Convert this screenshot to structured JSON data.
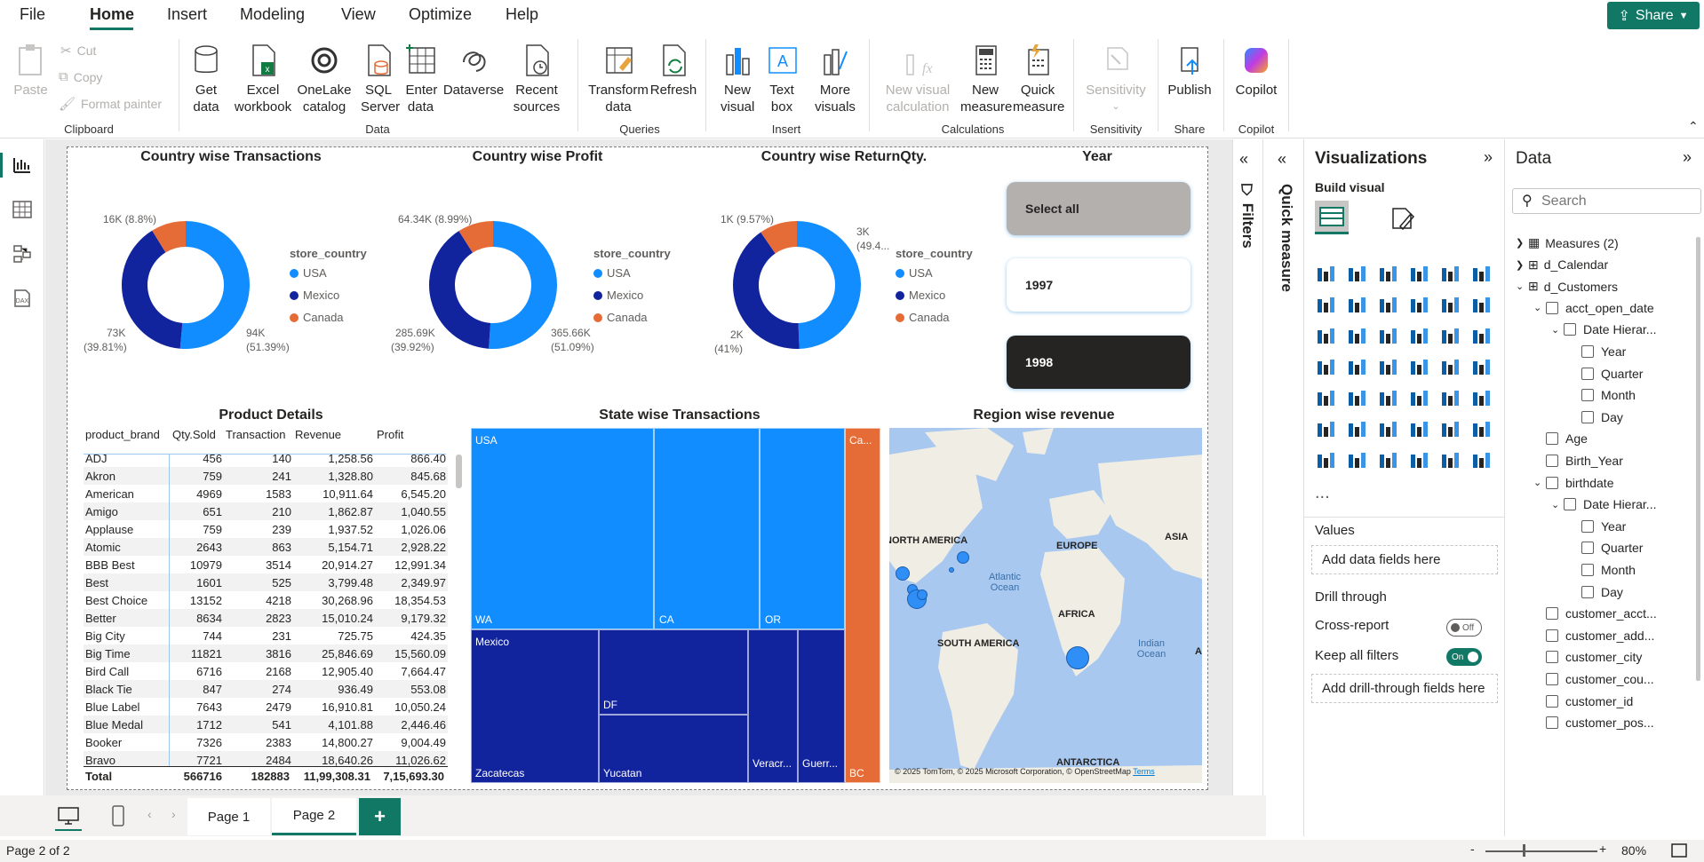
{
  "menu": {
    "file": "File",
    "home": "Home",
    "insert": "Insert",
    "modeling": "Modeling",
    "view": "View",
    "optimize": "Optimize",
    "help": "Help",
    "share": "Share"
  },
  "ribbon": {
    "clipboard": {
      "paste": "Paste",
      "cut": "Cut",
      "copy": "Copy",
      "format_painter": "Format painter",
      "label": "Clipboard"
    },
    "data": {
      "get_data": "Get data",
      "excel": "Excel workbook",
      "onelake": "OneLake catalog",
      "sql": "SQL Server",
      "enter": "Enter data",
      "dataverse": "Dataverse",
      "recent": "Recent sources",
      "label": "Data"
    },
    "queries": {
      "transform": "Transform data",
      "refresh": "Refresh",
      "label": "Queries"
    },
    "insert": {
      "new_visual": "New visual",
      "text_box": "Text box",
      "more_visuals": "More visuals",
      "label": "Insert"
    },
    "calculations": {
      "new_visual_calc": "New visual calculation",
      "new_measure": "New measure",
      "quick_measure": "Quick measure",
      "label": "Calculations"
    },
    "sensitivity": {
      "btn": "Sensitivity",
      "label": "Sensitivity"
    },
    "share": {
      "publish": "Publish",
      "label": "Share"
    },
    "copilot": {
      "btn": "Copilot",
      "label": "Copilot"
    }
  },
  "donuts": [
    {
      "title": "Country wise Transactions",
      "legend_title": "store_country",
      "legend": [
        "USA",
        "Mexico",
        "Canada"
      ],
      "values": [
        51.39,
        39.81,
        8.8
      ],
      "labels": {
        "canada": "16K (8.8%)",
        "mexico_a": "73K",
        "mexico_b": "(39.81%)",
        "usa_a": "94K",
        "usa_b": "(51.39%)"
      }
    },
    {
      "title": "Country wise Profit",
      "legend_title": "store_country",
      "legend": [
        "USA",
        "Mexico",
        "Canada"
      ],
      "values": [
        51.09,
        39.92,
        8.99
      ],
      "labels": {
        "canada": "64.34K (8.99%)",
        "mexico_a": "285.69K",
        "mexico_b": "(39.92%)",
        "usa_a": "365.66K",
        "usa_b": "(51.09%)"
      }
    },
    {
      "title": "Country wise ReturnQty.",
      "legend_title": "store_country",
      "legend": [
        "USA",
        "Mexico",
        "Canada"
      ],
      "values": [
        49.4,
        41,
        9.57
      ],
      "labels": {
        "canada": "1K (9.57%)",
        "mexico_a": "2K",
        "mexico_b": "(41%)",
        "usa_a": "3K",
        "usa_b": "(49.4..."
      }
    }
  ],
  "colors": {
    "usa": "#118dff",
    "mexico": "#12239e",
    "canada": "#e66c37",
    "accent": "#117865"
  },
  "year_slicer": {
    "title": "Year",
    "options": [
      "Select all",
      "1997",
      "1998"
    ]
  },
  "product_table": {
    "title": "Product Details",
    "columns": [
      "product_brand",
      "Qty.Sold",
      "Transaction",
      "Revenue",
      "Profit"
    ],
    "rows": [
      [
        "ADJ",
        "456",
        "140",
        "1,258.56",
        "866.40"
      ],
      [
        "Akron",
        "759",
        "241",
        "1,328.80",
        "845.68"
      ],
      [
        "American",
        "4969",
        "1583",
        "10,911.64",
        "6,545.20"
      ],
      [
        "Amigo",
        "651",
        "210",
        "1,862.87",
        "1,040.55"
      ],
      [
        "Applause",
        "759",
        "239",
        "1,937.52",
        "1,026.06"
      ],
      [
        "Atomic",
        "2643",
        "863",
        "5,154.71",
        "2,928.22"
      ],
      [
        "BBB Best",
        "10979",
        "3514",
        "20,914.27",
        "12,991.34"
      ],
      [
        "Best",
        "1601",
        "525",
        "3,799.48",
        "2,349.97"
      ],
      [
        "Best Choice",
        "13152",
        "4218",
        "30,268.96",
        "18,354.53"
      ],
      [
        "Better",
        "8634",
        "2823",
        "15,010.24",
        "9,179.32"
      ],
      [
        "Big City",
        "744",
        "231",
        "725.75",
        "424.35"
      ],
      [
        "Big Time",
        "11821",
        "3816",
        "25,846.69",
        "15,560.09"
      ],
      [
        "Bird Call",
        "6716",
        "2168",
        "12,905.40",
        "7,664.47"
      ],
      [
        "Black Tie",
        "847",
        "274",
        "936.49",
        "553.08"
      ],
      [
        "Blue Label",
        "7643",
        "2479",
        "16,910.81",
        "10,050.24"
      ],
      [
        "Blue Medal",
        "1712",
        "541",
        "4,101.88",
        "2,446.46"
      ],
      [
        "Booker",
        "7326",
        "2383",
        "14,800.27",
        "9,004.49"
      ],
      [
        "Bravo",
        "7721",
        "2484",
        "18,640.26",
        "11,026.62"
      ]
    ],
    "total": [
      "Total",
      "566716",
      "182883",
      "11,99,308.31",
      "7,15,693.30"
    ]
  },
  "treemap": {
    "title": "State wise Transactions",
    "usa": "USA",
    "wa": "WA",
    "ca": "CA",
    "or": "OR",
    "mexico": "Mexico",
    "zacatecas": "Zacatecas",
    "df": "DF",
    "yucatan": "Yucatan",
    "veracruz": "Veracr...",
    "guerrero": "Guerr...",
    "canada": "Ca...",
    "bc": "BC"
  },
  "map": {
    "title": "Region wise revenue",
    "north_america": "NORTH AMERICA",
    "europe": "EUROPE",
    "asia": "ASIA",
    "africa": "AFRICA",
    "south_america": "SOUTH AMERICA",
    "antarctica": "ANTARCTICA",
    "atlantic": "Atlantic Ocean",
    "indian": "Indian Ocean",
    "attribution": "© 2025 TomTom, © 2025 Microsoft Corporation, © OpenStreetMap",
    "terms": "Terms",
    "a_edge": "A"
  },
  "filters": {
    "label": "Filters",
    "quick_measure": "Quick measure"
  },
  "viz_pane": {
    "title": "Visualizations",
    "build": "Build visual",
    "values": "Values",
    "add_data": "Add data fields here",
    "drill": "Drill through",
    "cross": "Cross-report",
    "cross_state": "Off",
    "keep": "Keep all filters",
    "keep_state": "On",
    "add_drill": "Add drill-through fields here",
    "more": "..."
  },
  "data_pane": {
    "title": "Data",
    "search_placeholder": "Search",
    "items": [
      "Measures (2)",
      "d_Calendar",
      "d_Customers",
      "acct_open_date",
      "Date Hierar...",
      "Year",
      "Quarter",
      "Month",
      "Day",
      "Age",
      "Birth_Year",
      "birthdate",
      "Date Hierar...",
      "Year",
      "Quarter",
      "Month",
      "Day",
      "customer_acct...",
      "customer_add...",
      "customer_city",
      "customer_cou...",
      "customer_id",
      "customer_pos..."
    ]
  },
  "pages": {
    "page1": "Page 1",
    "page2": "Page 2",
    "add": "+"
  },
  "status": {
    "page": "Page 2 of 2",
    "zoom": "80%",
    "minus": "-",
    "plus": "+"
  }
}
